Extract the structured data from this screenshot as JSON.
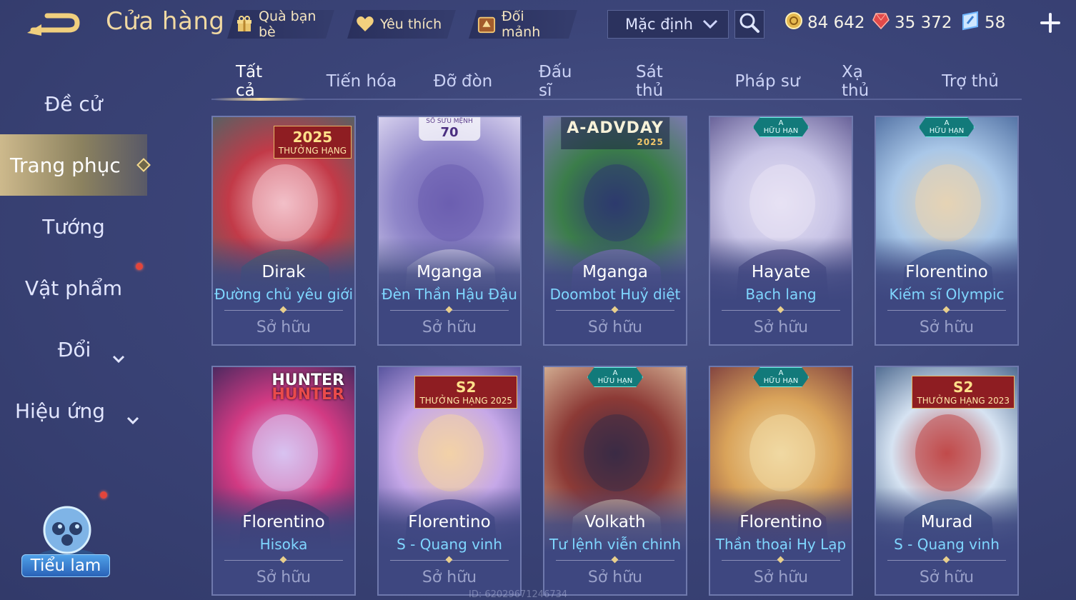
{
  "header": {
    "title": "Cửa hàng",
    "gift_label": "Quà bạn bè",
    "favorite_label": "Yêu thích",
    "exchange_label": "Đổi mảnh",
    "sort_value": "Mặc định",
    "currency_gold": "84 642",
    "currency_ruby": "35 372",
    "currency_voucher": "58"
  },
  "sidebar": {
    "items": [
      {
        "label": "Đề cử"
      },
      {
        "label": "Trang phục"
      },
      {
        "label": "Tướng"
      },
      {
        "label": "Vật phẩm"
      },
      {
        "label": "Đổi"
      },
      {
        "label": "Hiệu ứng"
      }
    ],
    "pet_label": "Tiểu lam"
  },
  "tabs": [
    "Tất cả",
    "Tiến hóa",
    "Đỡ đòn",
    "Đấu sĩ",
    "Sát thủ",
    "Pháp sư",
    "Xạ thủ",
    "Trợ thủ"
  ],
  "cards": [
    {
      "hero": "Dirak",
      "skin": "Đường chủ yêu giới",
      "status": "Sở hữu",
      "badge_type": "rank",
      "badge_top": "2025",
      "badge_text": "THƯỞNG HẠNG",
      "colors": [
        "#c23a48",
        "#3e6a6a",
        "#f2c0c8"
      ]
    },
    {
      "hero": "Mganga",
      "skin": "Đèn Thần Hậu Đậu",
      "status": "Sở hữu",
      "badge_type": "collection",
      "badge_top": "70",
      "badge_text": "SỔ SƯU MỆNH",
      "colors": [
        "#8f86c9",
        "#e9e4f7",
        "#6c5fb0"
      ]
    },
    {
      "hero": "Mganga",
      "skin": "Doombot Huỷ diệt",
      "status": "Sở hữu",
      "badge_type": "event",
      "badge_top": "A-ADVDAY",
      "badge_text": "2025",
      "colors": [
        "#3b7d4a",
        "#8a78c6",
        "#2d3a6e"
      ]
    },
    {
      "hero": "Hayate",
      "skin": "Bạch lang",
      "status": "Sở hữu",
      "badge_type": "limited",
      "badge_top": "A",
      "badge_text": "HỮU HẠN",
      "colors": [
        "#c8c4e6",
        "#514a86",
        "#e7e2f4"
      ]
    },
    {
      "hero": "Florentino",
      "skin": "Kiếm sĩ Olympic",
      "status": "Sở hữu",
      "badge_type": "limited",
      "badge_top": "A",
      "badge_text": "HỮU HẠN",
      "colors": [
        "#a9c7e8",
        "#3f5f95",
        "#e6d3b5"
      ]
    },
    {
      "hero": "Florentino",
      "skin": "Hisoka",
      "status": "Sở hữu",
      "badge_type": "logo",
      "badge_top": "HUNTER",
      "badge_text": "HUNTER",
      "colors": [
        "#d23a83",
        "#2b2557",
        "#d8c2f1"
      ]
    },
    {
      "hero": "Florentino",
      "skin": "S - Quang vinh",
      "status": "Sở hữu",
      "badge_type": "rank",
      "badge_top": "S2",
      "badge_text": "THƯỞNG HẠNG 2025",
      "colors": [
        "#c6a8e8",
        "#3c3f8c",
        "#f3d2a8"
      ]
    },
    {
      "hero": "Volkath",
      "skin": "Tư lệnh viễn chinh",
      "status": "Sở hữu",
      "badge_type": "limited",
      "badge_top": "A",
      "badge_text": "HỮU HẠN",
      "colors": [
        "#8c3a36",
        "#e2c7a6",
        "#3b2b45"
      ]
    },
    {
      "hero": "Florentino",
      "skin": "Thần thoại Hy Lạp",
      "status": "Sở hữu",
      "badge_type": "limited",
      "badge_top": "A",
      "badge_text": "HỮU HẠN",
      "colors": [
        "#d9a35a",
        "#6e2d3a",
        "#f0d9a3"
      ]
    },
    {
      "hero": "Murad",
      "skin": "S - Quang vinh",
      "status": "Sở hữu",
      "badge_type": "rank",
      "badge_top": "S2",
      "badge_text": "THƯỞNG HẠNG 2023",
      "colors": [
        "#d6e3f2",
        "#2f4f7a",
        "#c14a4a"
      ]
    }
  ],
  "watermark": "ID: 62029671246734",
  "colors": {
    "accent_gold": "#f1d79a",
    "skin_name": "#7fd6ff",
    "background": "#3b4478",
    "notification": "#e3453b"
  },
  "icons": {
    "back": "back-arrow-icon",
    "gift": "gift-icon",
    "favorite": "heart-icon",
    "exchange": "shard-chest-icon",
    "search": "search-icon",
    "gold": "gold-coin-icon",
    "ruby": "ruby-icon",
    "voucher": "voucher-icon",
    "plus": "plus-icon"
  }
}
